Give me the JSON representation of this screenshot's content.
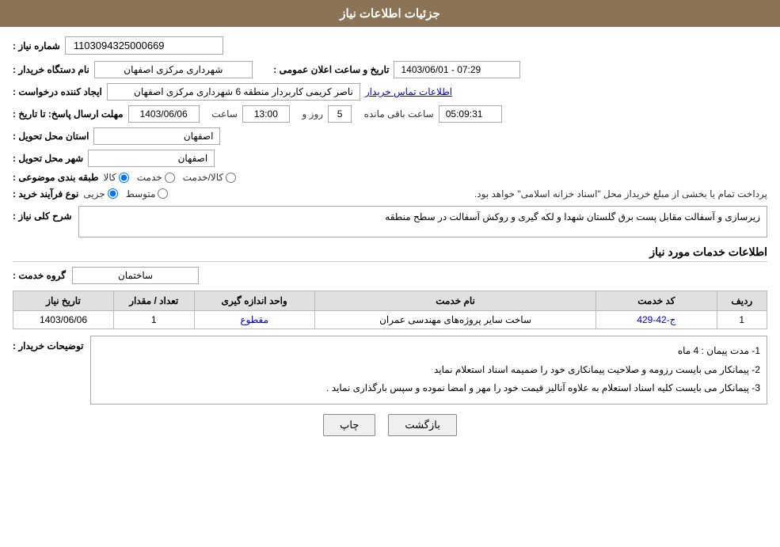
{
  "header": {
    "title": "جزئیات اطلاعات نیاز"
  },
  "fields": {
    "shomareNiaz_label": "شماره نیاز :",
    "shomareNiaz_value": "1103094325000669",
    "namdastgah_label": "نام دستگاه خریدار :",
    "namdastgah_value": "شهرداری مرکزی اصفهان",
    "ijadkonnende_label": "ایجاد کننده درخواست :",
    "ijadkonnende_value": "ناصر کریمی کاربردار منطقه 6 شهرداری مرکزی اصفهان",
    "ettelaatTamas_link": "اطلاعات تماس خریدار",
    "mohlat_label": "مهلت ارسال پاسخ: تا تاریخ :",
    "date_value": "1403/06/06",
    "saat_label": "ساعت",
    "saat_value": "13:00",
    "roz_label": "روز و",
    "roz_value": "5",
    "baghimandeh_label": "ساعت باقی مانده",
    "baghimandeh_value": "05:09:31",
    "taarikh_elan_label": "تاریخ و ساعت اعلان عمومی :",
    "taarikh_elan_value": "1403/06/01 - 07:29",
    "ostan_tahvil_label": "استان محل تحویل :",
    "ostan_tahvil_value": "اصفهان",
    "shahr_tahvil_label": "شهر محل تحویل :",
    "shahr_tahvil_value": "اصفهان",
    "tabaqebandi_label": "طبقه بندی موضوعی :",
    "tabaqe_kala": "کالا",
    "tabaqe_khedmat": "خدمت",
    "tabaqe_kala_khedmat": "کالا/خدمت",
    "noeFarayand_label": "نوع فرآیند خرید :",
    "noeFarayand_jozii": "جزیی",
    "noeFarayand_motavasset": "متوسط",
    "noeFarayand_note": "پرداخت تمام یا بخشی از مبلغ خریداز محل \"اسناد خزانه اسلامی\" خواهد بود.",
    "sharh_label": "شرح کلی نیاز :",
    "sharh_value": "زیرسازی و آسفالت مقابل پست برق گلستان شهدا و لکه گیری و روکش آسفالت در سطح منطقه",
    "khadamat_title": "اطلاعات خدمات مورد نیاز",
    "groheKhadamat_label": "گروه خدمت :",
    "groheKhadamat_value": "ساختمان",
    "table": {
      "headers": [
        "ردیف",
        "کد خدمت",
        "نام خدمت",
        "واحد اندازه گیری",
        "تعداد / مقدار",
        "تاریخ نیاز"
      ],
      "rows": [
        {
          "radif": "1",
          "code": "ج-42-429",
          "name": "ساخت سایر پروژه‌های مهندسی عمران",
          "unit": "مقطوع",
          "count": "1",
          "date": "1403/06/06"
        }
      ]
    },
    "tosihaat_label": "توضیحات خریدار :",
    "tosihaat_lines": [
      "1- مدت پیمان : 4 ماه",
      "2- پیمانکار می بایست رزومه و صلاحیت پیمانکاری خود را ضمیمه اسناد استعلام نماید",
      "3- پیمانکار می بایست کلیه اسناد استعلام به علاوه آنالیز قیمت خود را مهر و امضا نموده و سپس بارگذاری نماید ."
    ],
    "btn_back": "بازگشت",
    "btn_print": "چاپ"
  }
}
